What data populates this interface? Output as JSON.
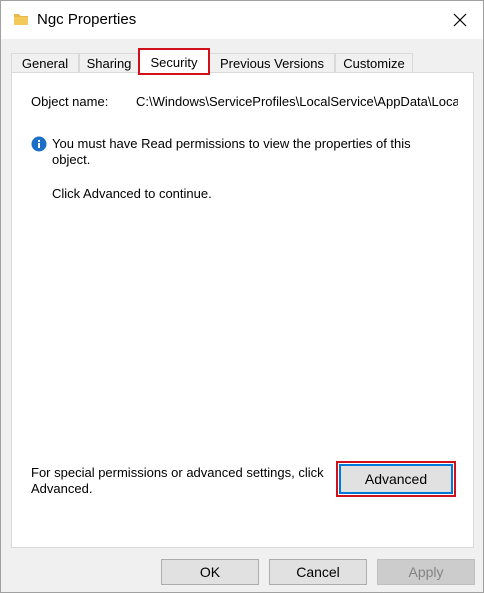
{
  "window": {
    "title": "Ngc Properties",
    "icon": "folder-icon"
  },
  "tabs": [
    {
      "label": "General",
      "active": false
    },
    {
      "label": "Sharing",
      "active": false
    },
    {
      "label": "Security",
      "active": true
    },
    {
      "label": "Previous Versions",
      "active": false
    },
    {
      "label": "Customize",
      "active": false
    }
  ],
  "security": {
    "object_name_label": "Object name:",
    "object_name_value": "C:\\Windows\\ServiceProfiles\\LocalService\\AppData\\Local\\Microsoft\\Ngc",
    "info_message": "You must have Read permissions to view the properties of this object.",
    "continue_message": "Click Advanced to continue.",
    "special_permissions_text": "For special permissions or advanced settings, click Advanced.",
    "advanced_label": "Advanced"
  },
  "footer": {
    "ok_label": "OK",
    "cancel_label": "Cancel",
    "apply_label": "Apply",
    "apply_enabled": false
  },
  "colors": {
    "highlight": "#d0111b",
    "info_icon": "#1a6fc7",
    "focus_border": "#0078d7",
    "folder": "#e8b84a"
  }
}
